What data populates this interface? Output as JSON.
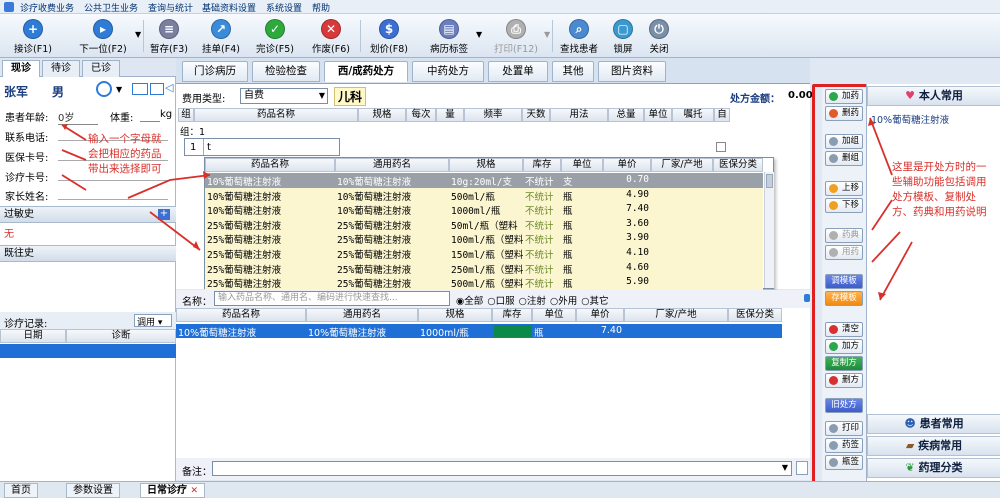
{
  "menu": [
    "诊疗收费业务",
    "公共卫生业务",
    "查询与统计",
    "基础资料设置",
    "系统设置",
    "帮助"
  ],
  "toolbar": [
    {
      "label": "接诊(F1)",
      "color": "#2e7cd6"
    },
    {
      "label": "下一位(F2)",
      "color": "#2e7cd6"
    },
    {
      "label": "暂存(F3)",
      "color": "#7a7fa0"
    },
    {
      "label": "挂单(F4)",
      "color": "#3a8bd9"
    },
    {
      "label": "完诊(F5)",
      "color": "#2eaa3c"
    },
    {
      "label": "作废(F6)",
      "color": "#d63a3a"
    },
    {
      "label": "划价(F8)",
      "color": "#3b6fd4"
    },
    {
      "label": "病历标签",
      "color": "#6a7ec0"
    },
    {
      "label": "打印(F12)",
      "color": "#b0b0b0"
    },
    {
      "label": "查找患者",
      "color": "#4a8ad0"
    },
    {
      "label": "锁屏",
      "color": "#3a9ad0"
    },
    {
      "label": "关闭",
      "color": "#7a8fa8"
    }
  ],
  "left_tabs": [
    "现诊",
    "待诊",
    "已诊"
  ],
  "patient": {
    "name": "张军",
    "gender": "男",
    "age_label": "患者年龄:",
    "age_value": "0岁",
    "weight_label": "体重:",
    "weight_unit": "kg",
    "phone_label": "联系电话:",
    "insurance_label": "医保卡号:",
    "card_label": "诊疗卡号:",
    "parent_label": "家长姓名:"
  },
  "allergy": {
    "title": "过敏史",
    "value": "无"
  },
  "history": {
    "title": "既往史"
  },
  "records": {
    "title": "诊疗记录:",
    "dropdown": "调用",
    "col_date": "日期",
    "col_diag": "诊断"
  },
  "tabs": [
    "门诊病历",
    "检验检查",
    "西/成药处方",
    "中药处方",
    "处置单",
    "其他",
    "图片资料"
  ],
  "rx": {
    "fee_type_label": "费用类型:",
    "fee_type_value": "自费",
    "dept": "儿科",
    "amount_label": "处方金额：",
    "amount_value": "0.00",
    "columns": [
      "组",
      "药品名称",
      "规格",
      "每次",
      "量",
      "频率",
      "天数",
      "用法",
      "总量",
      "单位",
      "嘱托",
      "自"
    ],
    "group_label": "组：1",
    "row_no": "1",
    "row_input": "t"
  },
  "popup": {
    "columns": [
      "药品名称",
      "通用药名",
      "规格",
      "库存",
      "单位",
      "单价",
      "厂家/产地",
      "医保分类"
    ],
    "rows": [
      [
        "10%葡萄糖注射液",
        "10%葡萄糖注射液",
        "10g:20ml/支",
        "不统计",
        "支",
        "0.70"
      ],
      [
        "10%葡萄糖注射液",
        "10%葡萄糖注射液",
        "500ml/瓶",
        "不统计",
        "瓶",
        "4.90"
      ],
      [
        "10%葡萄糖注射液",
        "10%葡萄糖注射液",
        "1000ml/瓶",
        "不统计",
        "瓶",
        "7.40"
      ],
      [
        "25%葡萄糖注射液",
        "25%葡萄糖注射液",
        "50ml/瓶（塑料",
        "不统计",
        "瓶",
        "3.60"
      ],
      [
        "25%葡萄糖注射液",
        "25%葡萄糖注射液",
        "100ml/瓶（塑料",
        "不统计",
        "瓶",
        "3.90"
      ],
      [
        "25%葡萄糖注射液",
        "25%葡萄糖注射液",
        "150ml/瓶（塑料",
        "不统计",
        "瓶",
        "4.10"
      ],
      [
        "25%葡萄糖注射液",
        "25%葡萄糖注射液",
        "250ml/瓶（塑料",
        "不统计",
        "瓶",
        "4.60"
      ],
      [
        "25%葡萄糖注射液",
        "25%葡萄糖注射液",
        "500ml/瓶（塑料",
        "不统计",
        "瓶",
        "5.90"
      ]
    ]
  },
  "search": {
    "label": "名称：",
    "placeholder": "输入药品名称、通用名、编码进行快速查找...",
    "radios": [
      "全部",
      "口服",
      "注射",
      "外用",
      "其它"
    ]
  },
  "lower": {
    "columns": [
      "药品名称",
      "通用药名",
      "规格",
      "库存",
      "单位",
      "单价",
      "厂家/产地",
      "医保分类"
    ],
    "row": [
      "10%葡萄糖注射液",
      "10%葡萄糖注射液",
      "1000ml/瓶",
      "",
      "瓶",
      "7.40"
    ]
  },
  "remark_label": "备注：",
  "side_buttons": [
    {
      "label": "加药",
      "dot": "#2aa84a"
    },
    {
      "label": "删药",
      "dot": "#e05a2a"
    },
    {
      "label": "加组",
      "dot": "#8a9cb0"
    },
    {
      "label": "删组",
      "dot": "#8a9cb0"
    },
    {
      "label": "上移",
      "dot": "#f0a020"
    },
    {
      "label": "下移",
      "dot": "#f0a020"
    },
    {
      "label": "药典",
      "dot": "#b0b0b0"
    },
    {
      "label": "用药",
      "dot": "#b0b0b0"
    },
    {
      "label": "调模板"
    },
    {
      "label": "存模板"
    },
    {
      "label": "清空",
      "dot": "#d83030"
    },
    {
      "label": "加方",
      "dot": "#2aa84a"
    },
    {
      "label": "复制方"
    },
    {
      "label": "删方",
      "dot": "#d83030"
    },
    {
      "label": "旧处方"
    },
    {
      "label": "打印",
      "dot": "#8a9cb0"
    },
    {
      "label": "药签",
      "dot": "#8a9cb0"
    },
    {
      "label": "瓶签",
      "dot": "#8a9cb0"
    }
  ],
  "far_right": {
    "top_title": "本人常用",
    "item": "10%葡萄糖注射液",
    "sections": [
      "患者常用",
      "疾病常用",
      "药理分类"
    ]
  },
  "annotations": {
    "left": "输入一个字母就会把相应的药品带出来选择即可",
    "right": "这里是开处方时的一些辅助功能包括调用处方模板、复制处方、药典和用药说明"
  },
  "status_tabs": [
    "首页",
    "参数设置",
    "日常诊疗"
  ],
  "colors": {
    "accent": "#1f6fd6",
    "annotation": "#d9302a",
    "selected_row": "#1f6fd6",
    "popup_highlight": "#fbf6d0"
  }
}
